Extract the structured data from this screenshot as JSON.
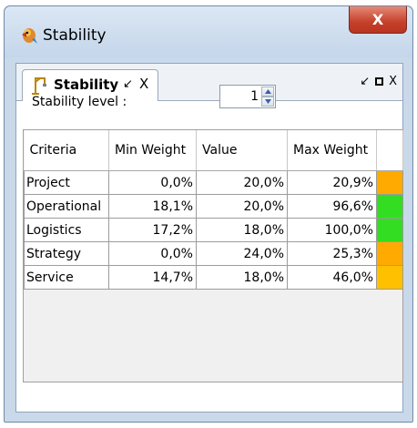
{
  "window": {
    "title": "Stability",
    "close_glyph": "X",
    "icon": "parrot-app-icon"
  },
  "tab": {
    "label": "Stability",
    "pin_glyph": "↙",
    "close_glyph": "X",
    "icon": "crane-icon"
  },
  "pane_controls": {
    "pin_glyph": "↙",
    "close_glyph": "X"
  },
  "stability": {
    "label": "Stability level :",
    "value": "1"
  },
  "grid": {
    "columns": [
      "Criteria",
      "Min Weight",
      "Value",
      "Max Weight",
      ""
    ],
    "rows": [
      {
        "criteria": "Project",
        "min": "0,0%",
        "value": "20,0%",
        "max": "20,9%",
        "status_color": "#ffaa00"
      },
      {
        "criteria": "Operational",
        "min": "18,1%",
        "value": "20,0%",
        "max": "96,6%",
        "status_color": "#33dd22"
      },
      {
        "criteria": "Logistics",
        "min": "17,2%",
        "value": "18,0%",
        "max": "100,0%",
        "status_color": "#33dd22"
      },
      {
        "criteria": "Strategy",
        "min": "0,0%",
        "value": "24,0%",
        "max": "25,3%",
        "status_color": "#ffaa00"
      },
      {
        "criteria": "Service",
        "min": "14,7%",
        "value": "18,0%",
        "max": "46,0%",
        "status_color": "#ffc000"
      }
    ]
  }
}
